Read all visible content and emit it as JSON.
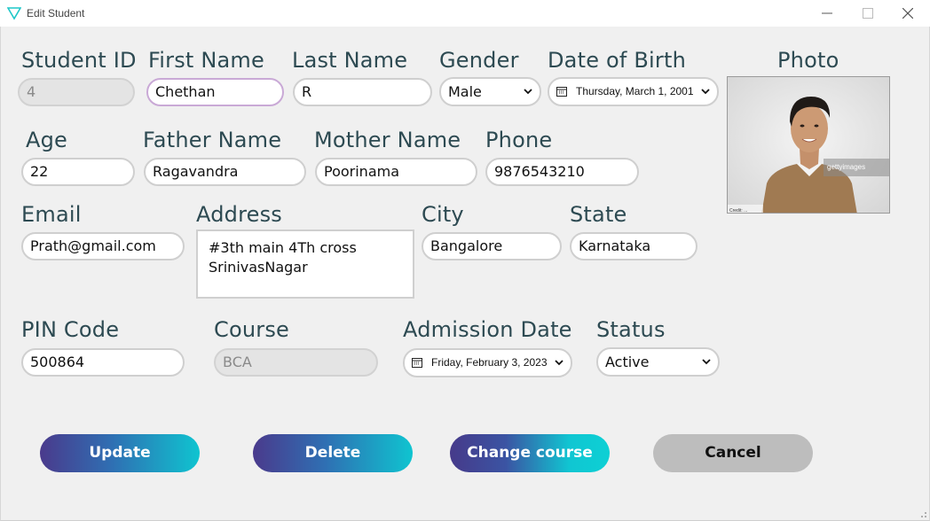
{
  "window": {
    "title": "Edit Student",
    "icon": "triangle-logo-icon",
    "accent": "#1fc7c8"
  },
  "labels": {
    "student_id": "Student ID",
    "first_name": "First Name",
    "last_name": "Last Name",
    "gender": "Gender",
    "dob": "Date of Birth",
    "photo": "Photo",
    "age": "Age",
    "father_name": "Father Name",
    "mother_name": "Mother Name",
    "phone": "Phone",
    "email": "Email",
    "address": "Address",
    "city": "City",
    "state": "State",
    "pin": "PIN Code",
    "course": "Course",
    "admission_date": "Admission Date",
    "status": "Status"
  },
  "values": {
    "student_id": "4",
    "first_name": "Chethan",
    "last_name": "R",
    "gender": "Male",
    "dob": "Thursday, March 1, 2001",
    "age": "22",
    "father_name": "Ragavandra",
    "mother_name": "Poorinama",
    "phone": "9876543210",
    "email": "Prath@gmail.com",
    "address_line1": "#3th main 4Th cross",
    "address_line2": "SrinivasNagar",
    "city": "Bangalore",
    "state": "Karnataka",
    "pin": "500864",
    "course": "BCA",
    "admission_date": "Friday, February 3, 2023",
    "status": "Active"
  },
  "photo": {
    "watermark": "gettyimages",
    "caption": "Credit: ..."
  },
  "buttons": {
    "update": "Update",
    "delete": "Delete",
    "change_course": "Change course",
    "cancel": "Cancel"
  },
  "colors": {
    "label": "#2d4a52",
    "button_gradient_start": "#4a3a8c",
    "button_gradient_end": "#0fc4d0",
    "cancel_button": "#bdbdbd"
  }
}
